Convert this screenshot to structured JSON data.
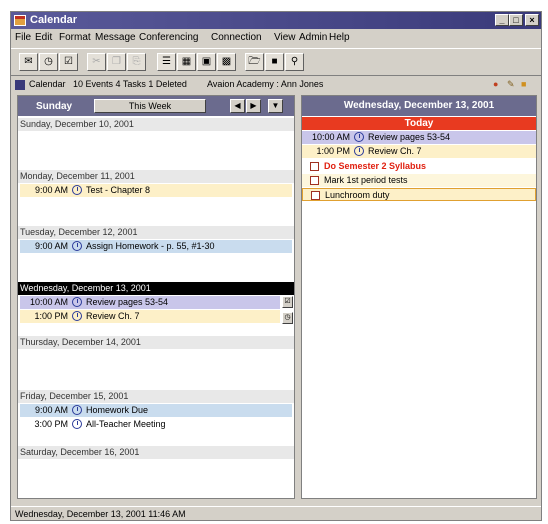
{
  "window": {
    "title": "Calendar"
  },
  "window_controls": {
    "minimize": "_",
    "maximize": "□",
    "close": "×"
  },
  "menu": [
    "File",
    "Edit",
    "Format",
    "Message",
    "Conferencing",
    "Connection",
    "View",
    "Admin",
    "Help"
  ],
  "info": {
    "view": "Calendar",
    "summary": "10 Events 4 Tasks 1 Deleted",
    "account": "Avaion Academy : Ann Jones"
  },
  "week": {
    "start_label": "Sunday",
    "range_label": "This Week",
    "days": [
      {
        "header": "Sunday, December 10, 2001",
        "events": []
      },
      {
        "header": "Monday, December 11, 2001",
        "events": [
          {
            "time": "9:00 AM",
            "title": "Test - Chapter 8"
          }
        ]
      },
      {
        "header": "Tuesday, December 12, 2001",
        "events": [
          {
            "time": "9:00 AM",
            "title": "Assign Homework - p. 55, #1-30"
          }
        ]
      },
      {
        "header": "Wednesday, December 13, 2001",
        "events": [
          {
            "time": "10:00 AM",
            "title": "Review pages 53-54"
          },
          {
            "time": "1:00 PM",
            "title": "Review Ch. 7"
          }
        ]
      },
      {
        "header": "Thursday, December 14, 2001",
        "events": []
      },
      {
        "header": "Friday, December 15, 2001",
        "events": [
          {
            "time": "9:00 AM",
            "title": "Homework Due"
          },
          {
            "time": "3:00 PM",
            "title": "All-Teacher Meeting"
          }
        ]
      },
      {
        "header": "Saturday, December 16, 2001",
        "events": []
      }
    ]
  },
  "day_view": {
    "header": "Wednesday, December 13, 2001",
    "today_label": "Today",
    "events": [
      {
        "time": "10:00 AM",
        "title": "Review pages 53-54"
      },
      {
        "time": "1:00 PM",
        "title": "Review Ch. 7"
      }
    ],
    "tasks": [
      {
        "title": "Do Semester 2 Syllabus",
        "status": "overdue"
      },
      {
        "title": "Mark 1st period tests",
        "status": "open"
      },
      {
        "title": "Lunchroom duty",
        "status": "done"
      }
    ]
  },
  "status": "Wednesday, December 13, 2001 11:46 AM",
  "colors": {
    "title_bar": "#3a3a7a",
    "pane_header": "#6b6b8e",
    "today": "#e83a20",
    "overdue_task": "#e02010"
  }
}
